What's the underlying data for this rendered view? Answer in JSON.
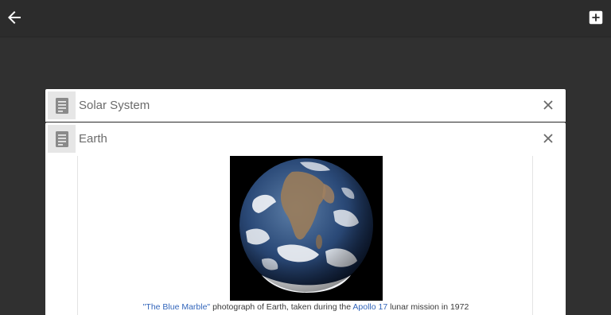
{
  "toolbar": {
    "back_icon": "arrow-left-icon",
    "add_icon": "add-box-icon"
  },
  "tabs": [
    {
      "title": "Solar System",
      "icon": "article-icon",
      "close_icon": "close-icon"
    },
    {
      "title": "Earth",
      "icon": "article-icon",
      "close_icon": "close-icon"
    }
  ],
  "article": {
    "image_subject": "Earth viewed from space",
    "caption": {
      "link1": "\"The Blue Marble\"",
      "text1": " photograph of Earth, taken during the ",
      "link2": "Apollo 17",
      "text2": " lunar mission in 1972"
    }
  },
  "colors": {
    "background": "#303030",
    "link": "#3366bb",
    "card": "#ffffff"
  }
}
